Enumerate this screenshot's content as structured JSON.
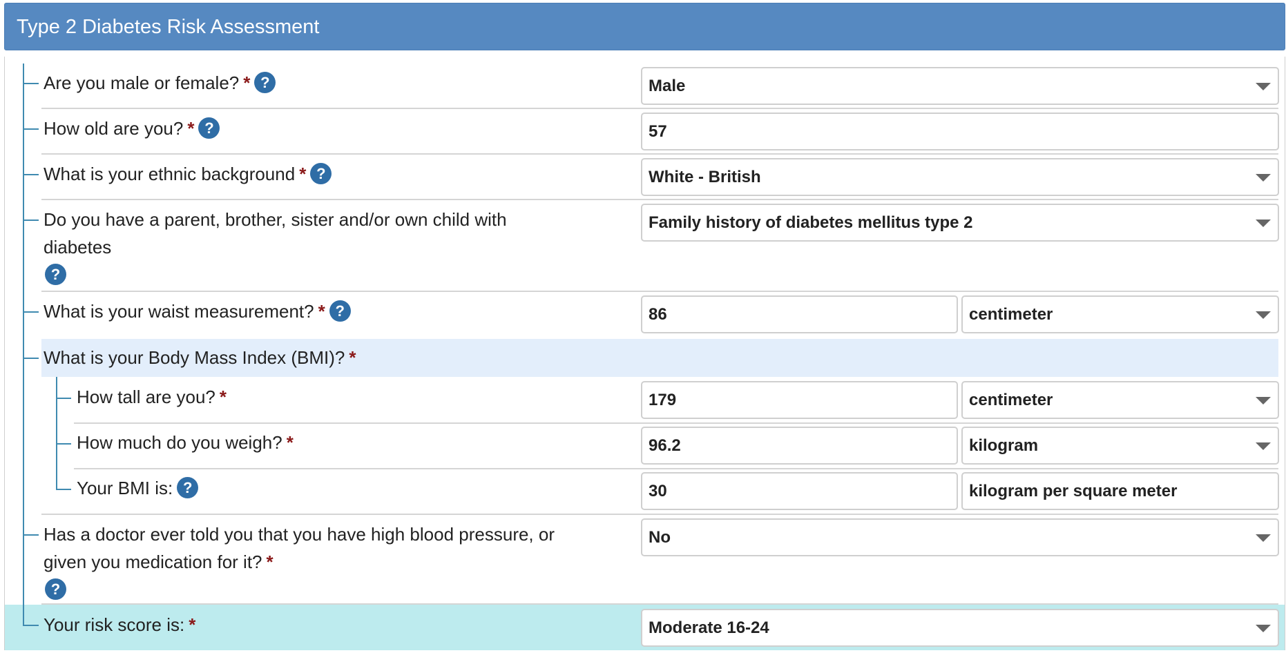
{
  "header": {
    "title": "Type 2 Diabetes Risk Assessment"
  },
  "required_marker": "*",
  "help_glyph": "?",
  "questions": {
    "sex": {
      "label": "Are you male or female?",
      "value": "Male"
    },
    "age": {
      "label": "How old are you?",
      "value": "57"
    },
    "ethnicity": {
      "label": "What is your ethnic background",
      "value": "White - British"
    },
    "family": {
      "label_line1": "Do you have a parent, brother, sister and/or own child with",
      "label_line2": "diabetes",
      "value": "Family history of diabetes mellitus type 2"
    },
    "waist": {
      "label": "What is your waist measurement?",
      "value": "86",
      "unit": "centimeter"
    },
    "bmi_group": {
      "label": "What is your Body Mass Index (BMI)?"
    },
    "height": {
      "label": "How tall are you?",
      "value": "179",
      "unit": "centimeter"
    },
    "weight": {
      "label": "How much do you weigh?",
      "value": "96.2",
      "unit": "kilogram"
    },
    "bmi": {
      "label": "Your BMI is:",
      "value": "30",
      "unit": "kilogram per square meter"
    },
    "bp": {
      "label_line1": "Has a doctor ever told you that you have high blood pressure, or",
      "label_line2": "given you medication for it?",
      "value": "No"
    },
    "risk": {
      "label": "Your risk score is:",
      "value": "Moderate 16-24"
    }
  },
  "colors": {
    "header_bg": "#5689c1",
    "tree_line": "#3f8ab0",
    "required": "#8b1a1a",
    "help_bg": "#2f6da6",
    "bmi_band": "#e3eefb",
    "risk_band": "#bdebee"
  }
}
